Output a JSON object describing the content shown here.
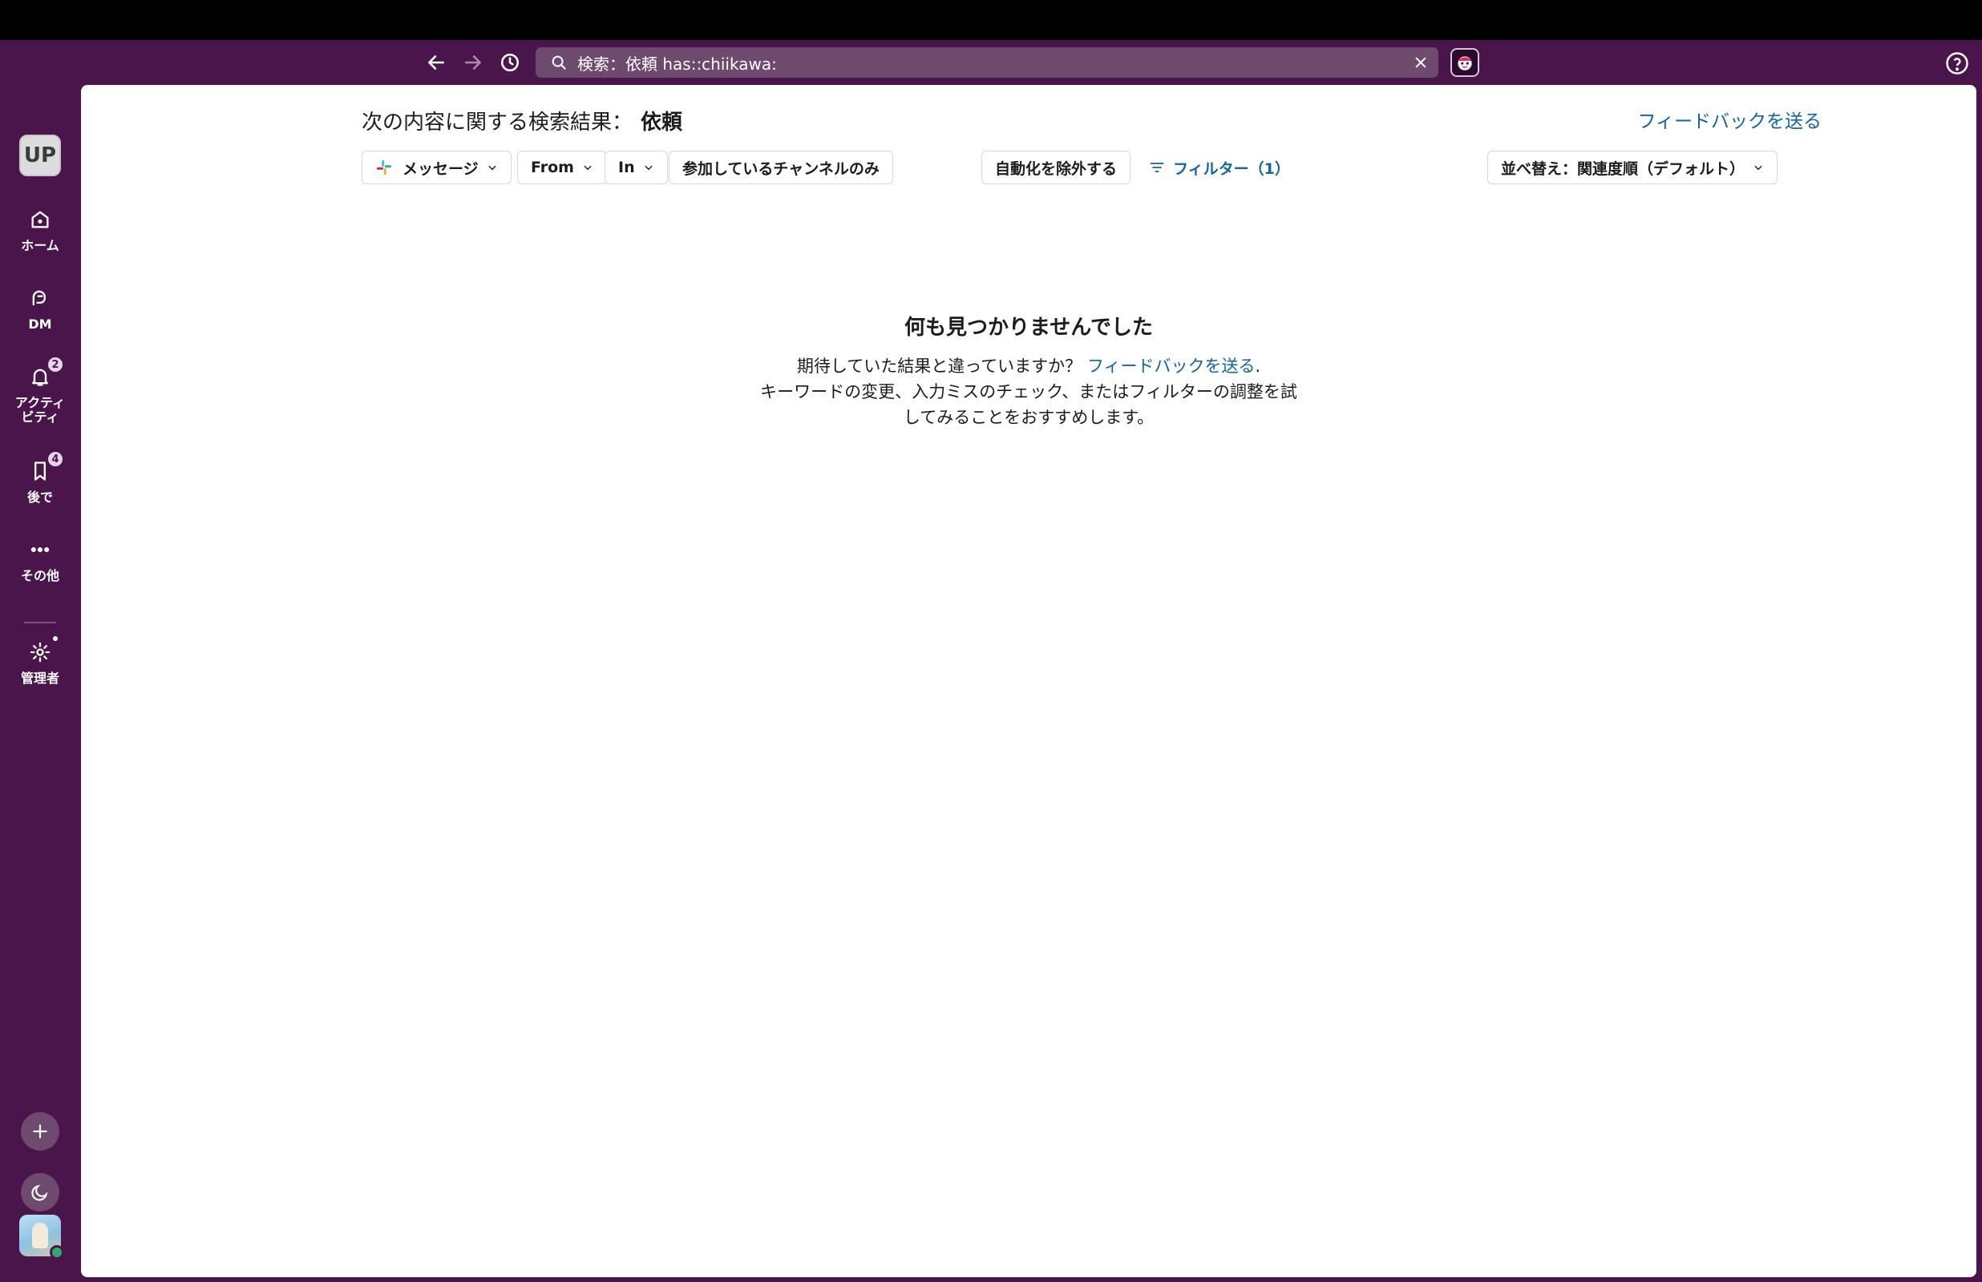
{
  "search": {
    "value": "検索：依頼 has::chiikawa:"
  },
  "workspace": {
    "initials": "UP"
  },
  "sidebar": {
    "items": [
      {
        "label": "ホーム"
      },
      {
        "label": "DM"
      },
      {
        "label": "アクティビティ",
        "badge": "2"
      },
      {
        "label": "後で",
        "badge": "4"
      },
      {
        "label": "その他"
      },
      {
        "label": "管理者"
      }
    ]
  },
  "main": {
    "title_prefix": "次の内容に関する検索結果：",
    "title_query": "依頼",
    "feedback_link": "フィードバックを送る",
    "filters": {
      "type": "メッセージ",
      "from": "From",
      "in": "In",
      "joined_only": "参加しているチャンネルのみ",
      "exclude_automation": "自動化を除外する",
      "filter": "フィルター（1）",
      "sort": "並べ替え：関連度順（デフォルト）"
    },
    "empty": {
      "heading": "何も見つかりませんでした",
      "line1_prefix": "期待していた結果と違っていますか？ ",
      "line1_link": "フィードバックを送る",
      "line1_suffix": ".",
      "line2": "キーワードの変更、入力ミスのチェック、またはフィルターの調整を試",
      "line3": "してみることをおすすめします。"
    }
  }
}
